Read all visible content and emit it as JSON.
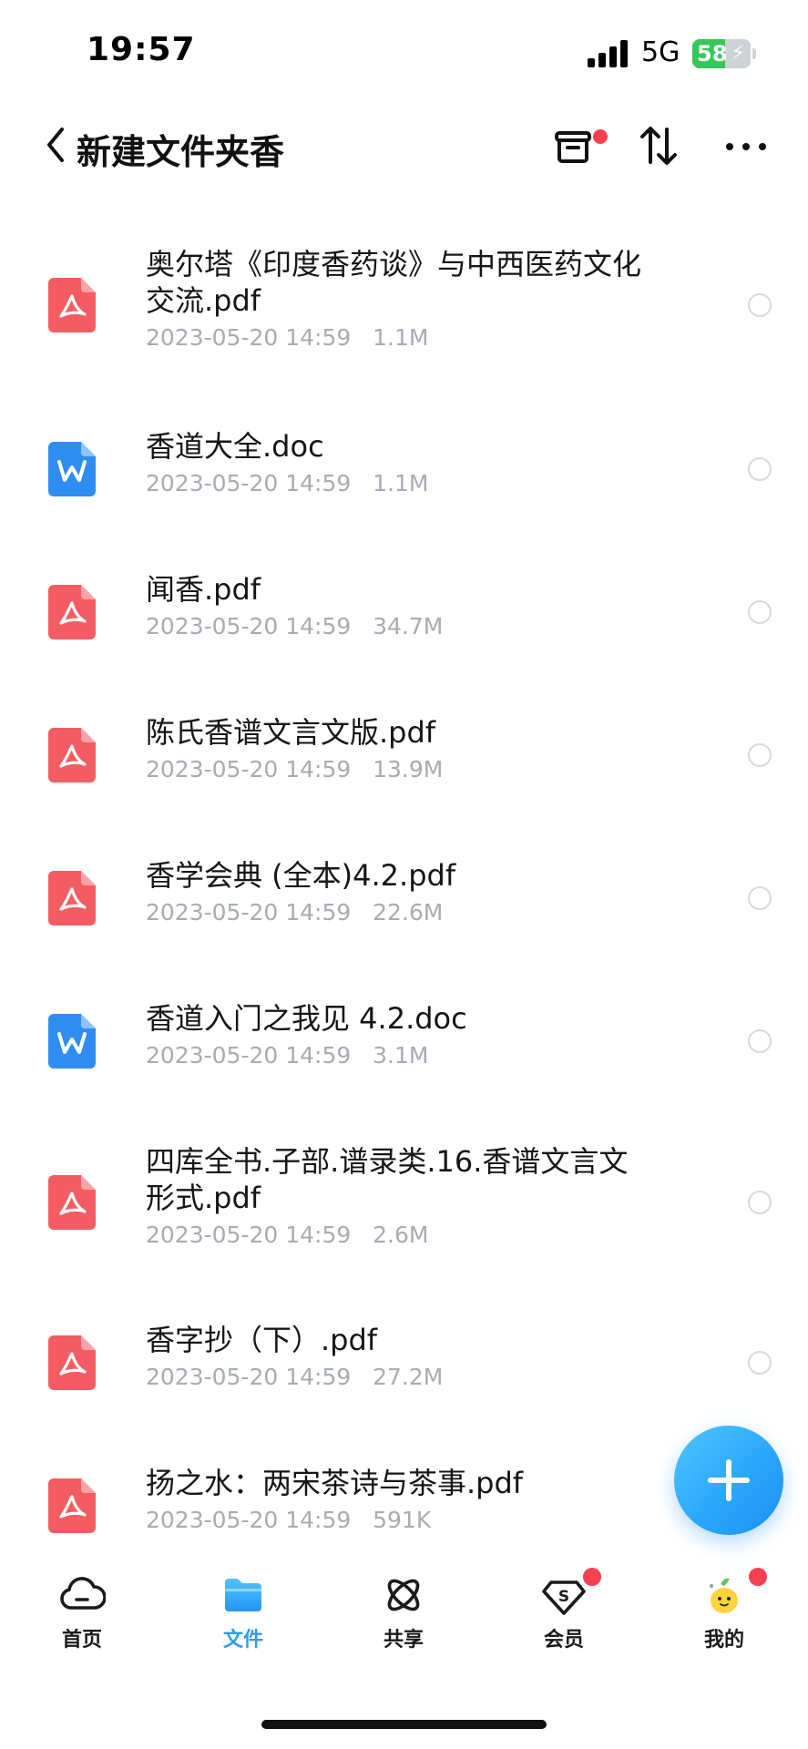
{
  "status_bar": {
    "time": "19:57",
    "network": "5G",
    "battery": "58"
  },
  "header": {
    "title": "新建文件夹香",
    "colors": {
      "notification_dot": "#f5414f"
    }
  },
  "files": [
    {
      "name": "奥尔塔《印度香药谈》与中西医药文化交流.pdf",
      "date": "2023-05-20 14:59",
      "size": "1.1M",
      "type": "pdf",
      "icon": "pdf-icon"
    },
    {
      "name": "香道大全.doc",
      "date": "2023-05-20 14:59",
      "size": "1.1M",
      "type": "doc",
      "icon": "word-icon"
    },
    {
      "name": "闻香.pdf",
      "date": "2023-05-20 14:59",
      "size": "34.7M",
      "type": "pdf",
      "icon": "pdf-icon"
    },
    {
      "name": "陈氏香谱文言文版.pdf",
      "date": "2023-05-20 14:59",
      "size": "13.9M",
      "type": "pdf",
      "icon": "pdf-icon"
    },
    {
      "name": "香学会典 (全本)4.2.pdf",
      "date": "2023-05-20 14:59",
      "size": "22.6M",
      "type": "pdf",
      "icon": "pdf-icon"
    },
    {
      "name": "香道入门之我见 4.2.doc",
      "date": "2023-05-20 14:59",
      "size": "3.1M",
      "type": "doc",
      "icon": "word-icon"
    },
    {
      "name": "四库全书.子部.谱录类.16.香谱文言文形式.pdf",
      "date": "2023-05-20 14:59",
      "size": "2.6M",
      "type": "pdf",
      "icon": "pdf-icon"
    },
    {
      "name": "香字抄（下）.pdf",
      "date": "2023-05-20 14:59",
      "size": "27.2M",
      "type": "pdf",
      "icon": "pdf-icon"
    },
    {
      "name": "扬之水：两宋茶诗与茶事.pdf",
      "date": "2023-05-20 14:59",
      "size": "591K",
      "type": "pdf",
      "icon": "pdf-icon"
    }
  ],
  "tabs": [
    {
      "label": "首页",
      "icon": "cloud-icon",
      "active": false,
      "badge": false
    },
    {
      "label": "文件",
      "icon": "folder-icon",
      "active": true,
      "badge": false
    },
    {
      "label": "共享",
      "icon": "share-atom-icon",
      "active": false,
      "badge": false
    },
    {
      "label": "会员",
      "icon": "vip-diamond-icon",
      "active": false,
      "badge": true
    },
    {
      "label": "我的",
      "icon": "avatar-mascot-icon",
      "active": false,
      "badge": true
    }
  ],
  "colors": {
    "accent": "#2a9df4",
    "pdf": "#f25c62",
    "doc": "#2f8df2",
    "meta_text": "#a7abb3"
  }
}
